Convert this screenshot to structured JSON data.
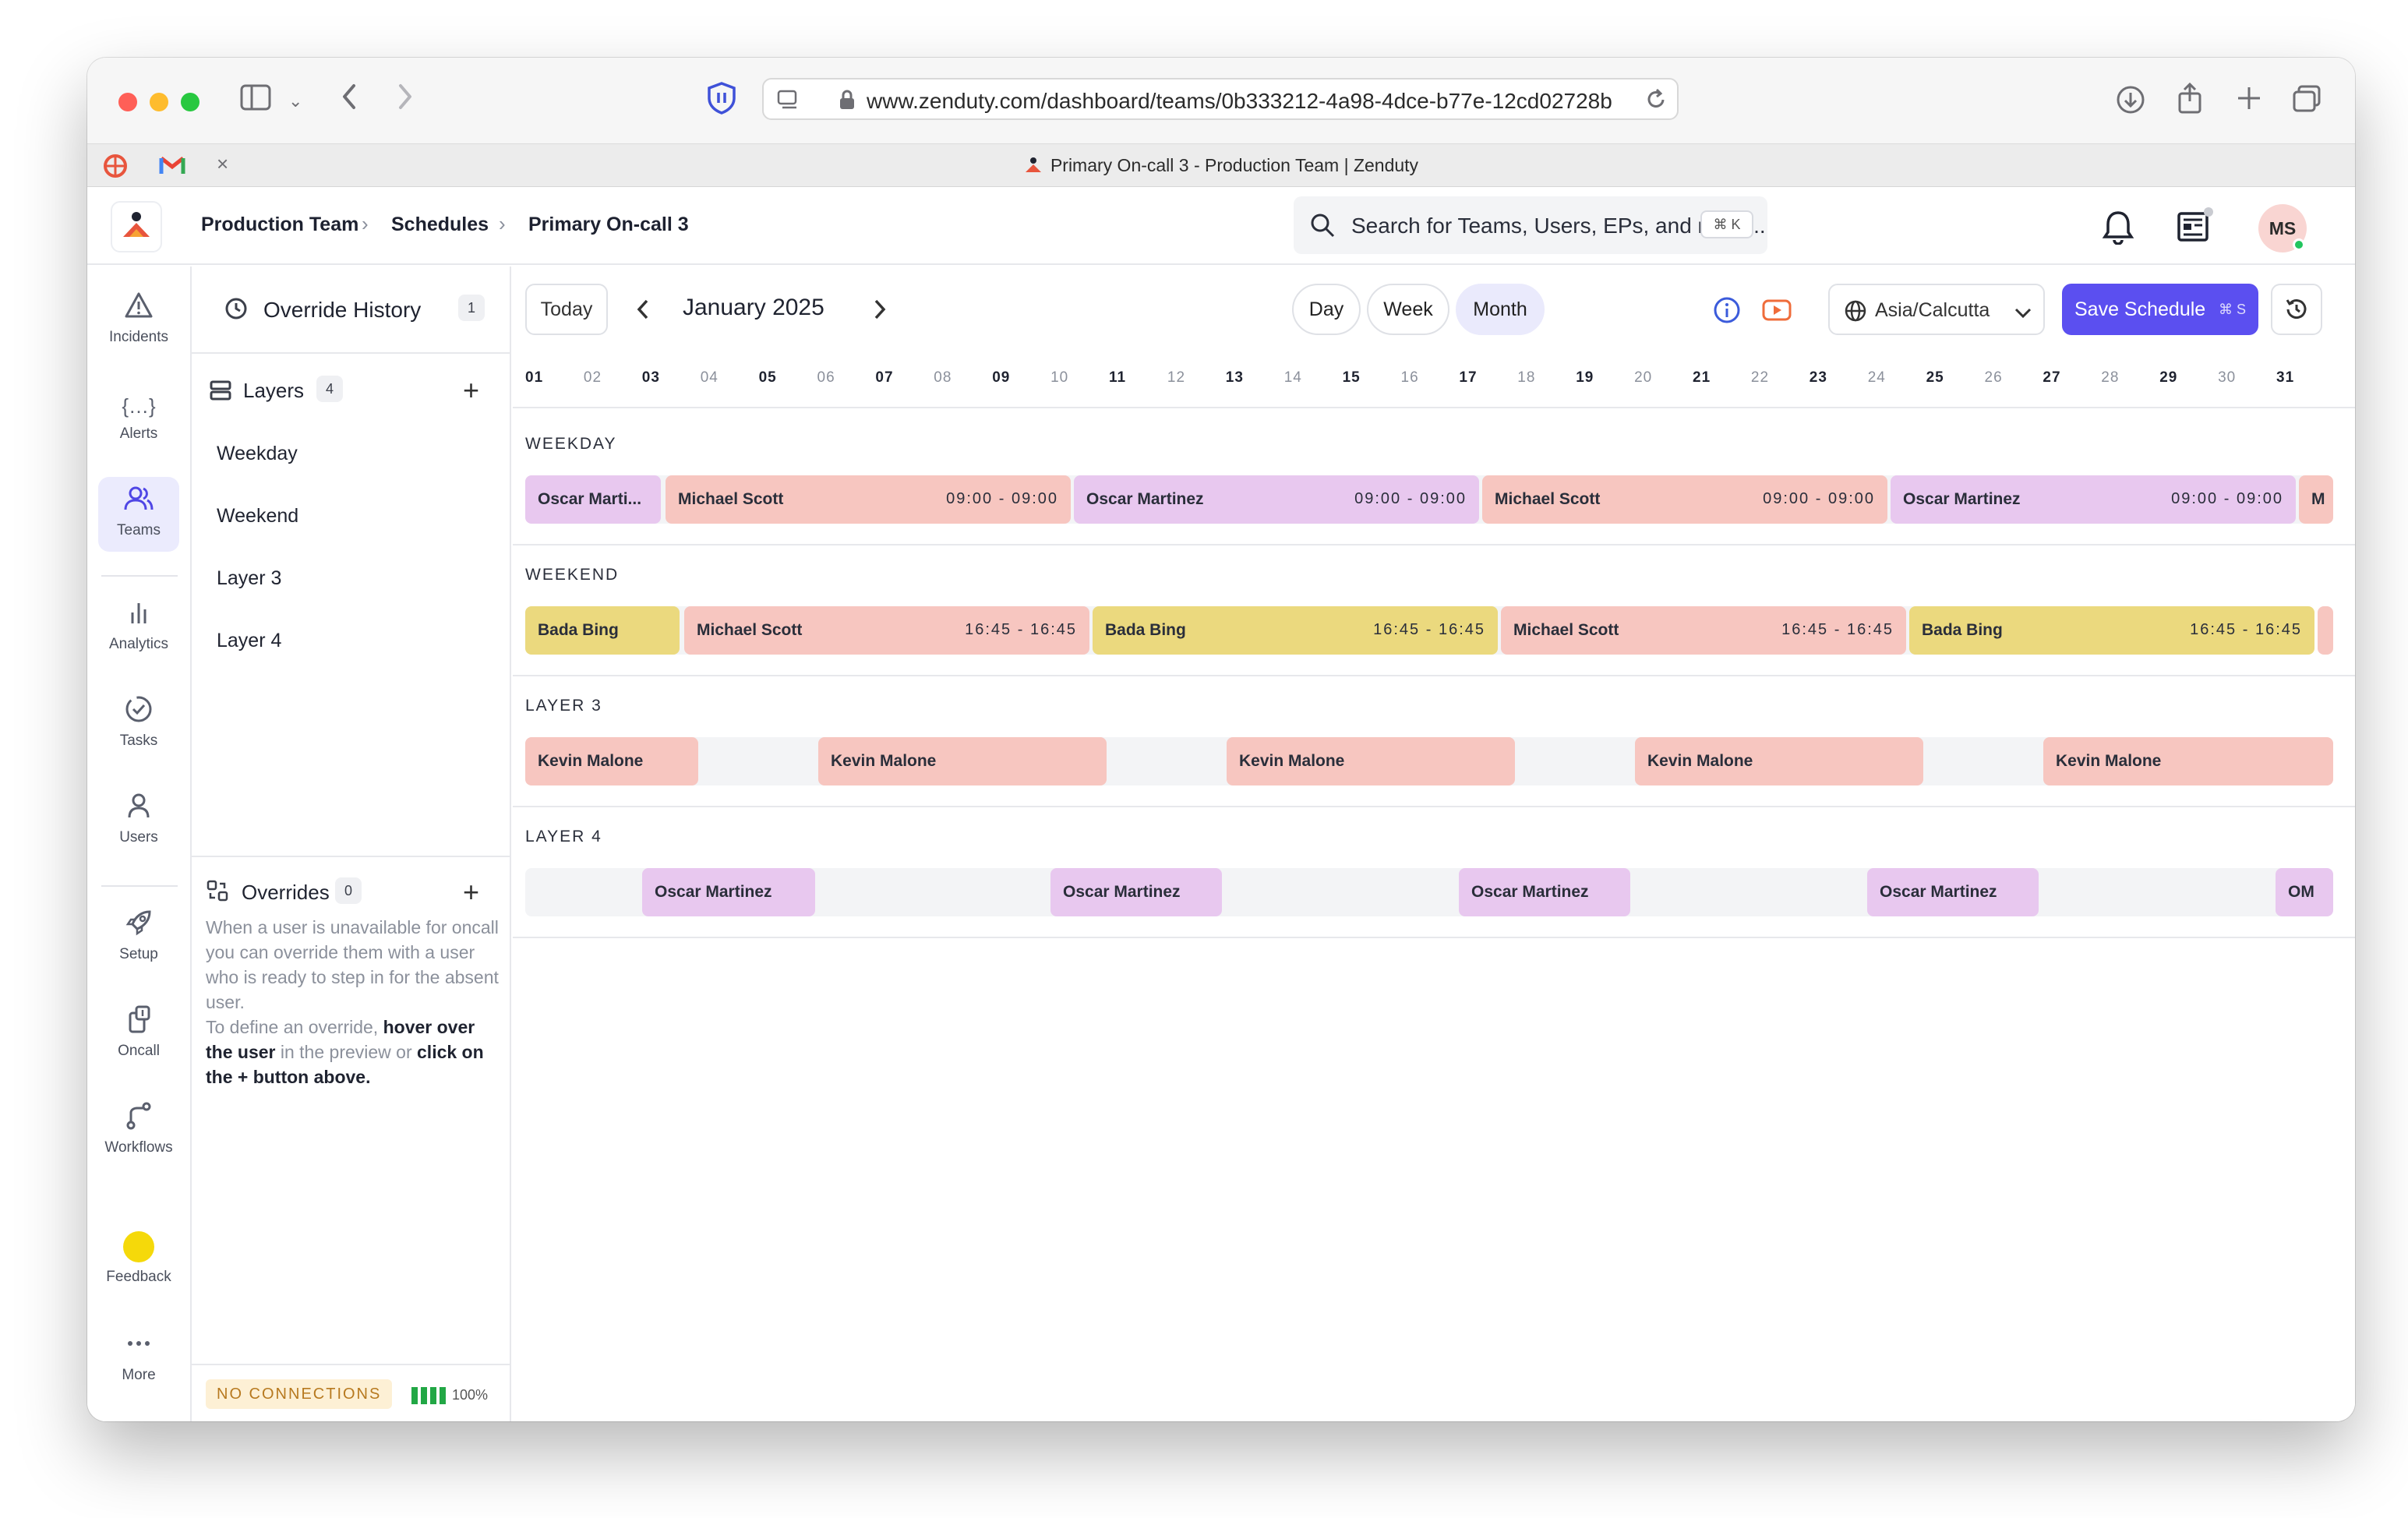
{
  "browser": {
    "url": "www.zenduty.com/dashboard/teams/0b333212-4a98-4dce-b77e-12cd02728b",
    "tab_title": "Primary On-call 3 - Production Team | Zenduty"
  },
  "breadcrumb": [
    "Production Team",
    "Schedules",
    "Primary On-call 3"
  ],
  "search": {
    "placeholder": "Search for Teams, Users, EPs, and more...",
    "shortcut": "⌘ K"
  },
  "user": {
    "initials": "MS"
  },
  "nav": [
    {
      "label": "Incidents",
      "icon": "warning-triangle-icon"
    },
    {
      "label": "Alerts",
      "icon": "braces-icon"
    },
    {
      "label": "Teams",
      "icon": "users-icon"
    },
    {
      "label": "Analytics",
      "icon": "bar-chart-icon"
    },
    {
      "label": "Tasks",
      "icon": "check-circle-icon"
    },
    {
      "label": "Users",
      "icon": "user-icon"
    },
    {
      "label": "Setup",
      "icon": "rocket-icon"
    },
    {
      "label": "Oncall",
      "icon": "oncall-icon"
    },
    {
      "label": "Workflows",
      "icon": "workflow-icon"
    },
    {
      "label": "Feedback",
      "icon": "feedback-dot-icon"
    },
    {
      "label": "More",
      "icon": "more-dots-icon"
    }
  ],
  "panel": {
    "override_history": {
      "label": "Override History",
      "count": "1"
    },
    "layers": {
      "label": "Layers",
      "count": "4",
      "items": [
        "Weekday",
        "Weekend",
        "Layer 3",
        "Layer 4"
      ]
    },
    "overrides": {
      "label": "Overrides",
      "count": "0",
      "help_1": "When a user is unavailable for oncall you can override them with a user who is ready to step in for the absent user.",
      "help_2_pre": "To define an override, ",
      "help_2_b1": "hover over the user",
      "help_2_mid": " in the preview or ",
      "help_2_b2": "click on the + button above."
    },
    "status": {
      "connection": "NO CONNECTIONS",
      "battery": "100%"
    }
  },
  "toolbar": {
    "today": "Today",
    "month": "January 2025",
    "views": [
      "Day",
      "Week",
      "Month"
    ],
    "active_view": "Month",
    "timezone": "Asia/Calcutta",
    "save": "Save Schedule",
    "save_shortcut": "⌘ S"
  },
  "days": [
    "01",
    "02",
    "03",
    "04",
    "05",
    "06",
    "07",
    "08",
    "09",
    "10",
    "11",
    "12",
    "13",
    "14",
    "15",
    "16",
    "17",
    "18",
    "19",
    "20",
    "21",
    "22",
    "23",
    "24",
    "25",
    "26",
    "27",
    "28",
    "29",
    "30",
    "31"
  ],
  "colors": {
    "accent": "#5b4ff0",
    "pink": "#f7c6c0",
    "violet": "#e8c8ef",
    "yellow": "#ebd97e"
  },
  "layers": [
    {
      "title": "WEEKDAY",
      "shifts": [
        {
          "name": "Oscar Marti...",
          "time": "",
          "color": "violet"
        },
        {
          "name": "Michael Scott",
          "time": "09:00 - 09:00",
          "color": "pink"
        },
        {
          "name": "Oscar Martinez",
          "time": "09:00 - 09:00",
          "color": "violet"
        },
        {
          "name": "Michael Scott",
          "time": "09:00 - 09:00",
          "color": "pink"
        },
        {
          "name": "Oscar Martinez",
          "time": "09:00 - 09:00",
          "color": "violet"
        },
        {
          "name": "M",
          "time": "",
          "color": "pink"
        }
      ]
    },
    {
      "title": "WEEKEND",
      "shifts": [
        {
          "name": "Bada Bing",
          "time": "",
          "color": "yellow"
        },
        {
          "name": "Michael Scott",
          "time": "16:45 - 16:45",
          "color": "pink"
        },
        {
          "name": "Bada Bing",
          "time": "16:45 - 16:45",
          "color": "yellow"
        },
        {
          "name": "Michael Scott",
          "time": "16:45 - 16:45",
          "color": "pink"
        },
        {
          "name": "Bada Bing",
          "time": "16:45 - 16:45",
          "color": "yellow"
        },
        {
          "name": "",
          "time": "",
          "color": "pink"
        }
      ]
    },
    {
      "title": "LAYER 3",
      "shifts": [
        {
          "name": "Kevin Malone",
          "time": "",
          "color": "pink"
        },
        {
          "name": "Kevin Malone",
          "time": "",
          "color": "pink"
        },
        {
          "name": "Kevin Malone",
          "time": "",
          "color": "pink"
        },
        {
          "name": "Kevin Malone",
          "time": "",
          "color": "pink"
        },
        {
          "name": "Kevin Malone",
          "time": "",
          "color": "pink"
        }
      ]
    },
    {
      "title": "LAYER 4",
      "shifts": [
        {
          "name": "Oscar Martinez",
          "time": "",
          "color": "violet"
        },
        {
          "name": "Oscar Martinez",
          "time": "",
          "color": "violet"
        },
        {
          "name": "Oscar Martinez",
          "time": "",
          "color": "violet"
        },
        {
          "name": "Oscar Martinez",
          "time": "",
          "color": "violet"
        },
        {
          "name": "OM",
          "time": "",
          "color": "violet"
        }
      ]
    }
  ]
}
